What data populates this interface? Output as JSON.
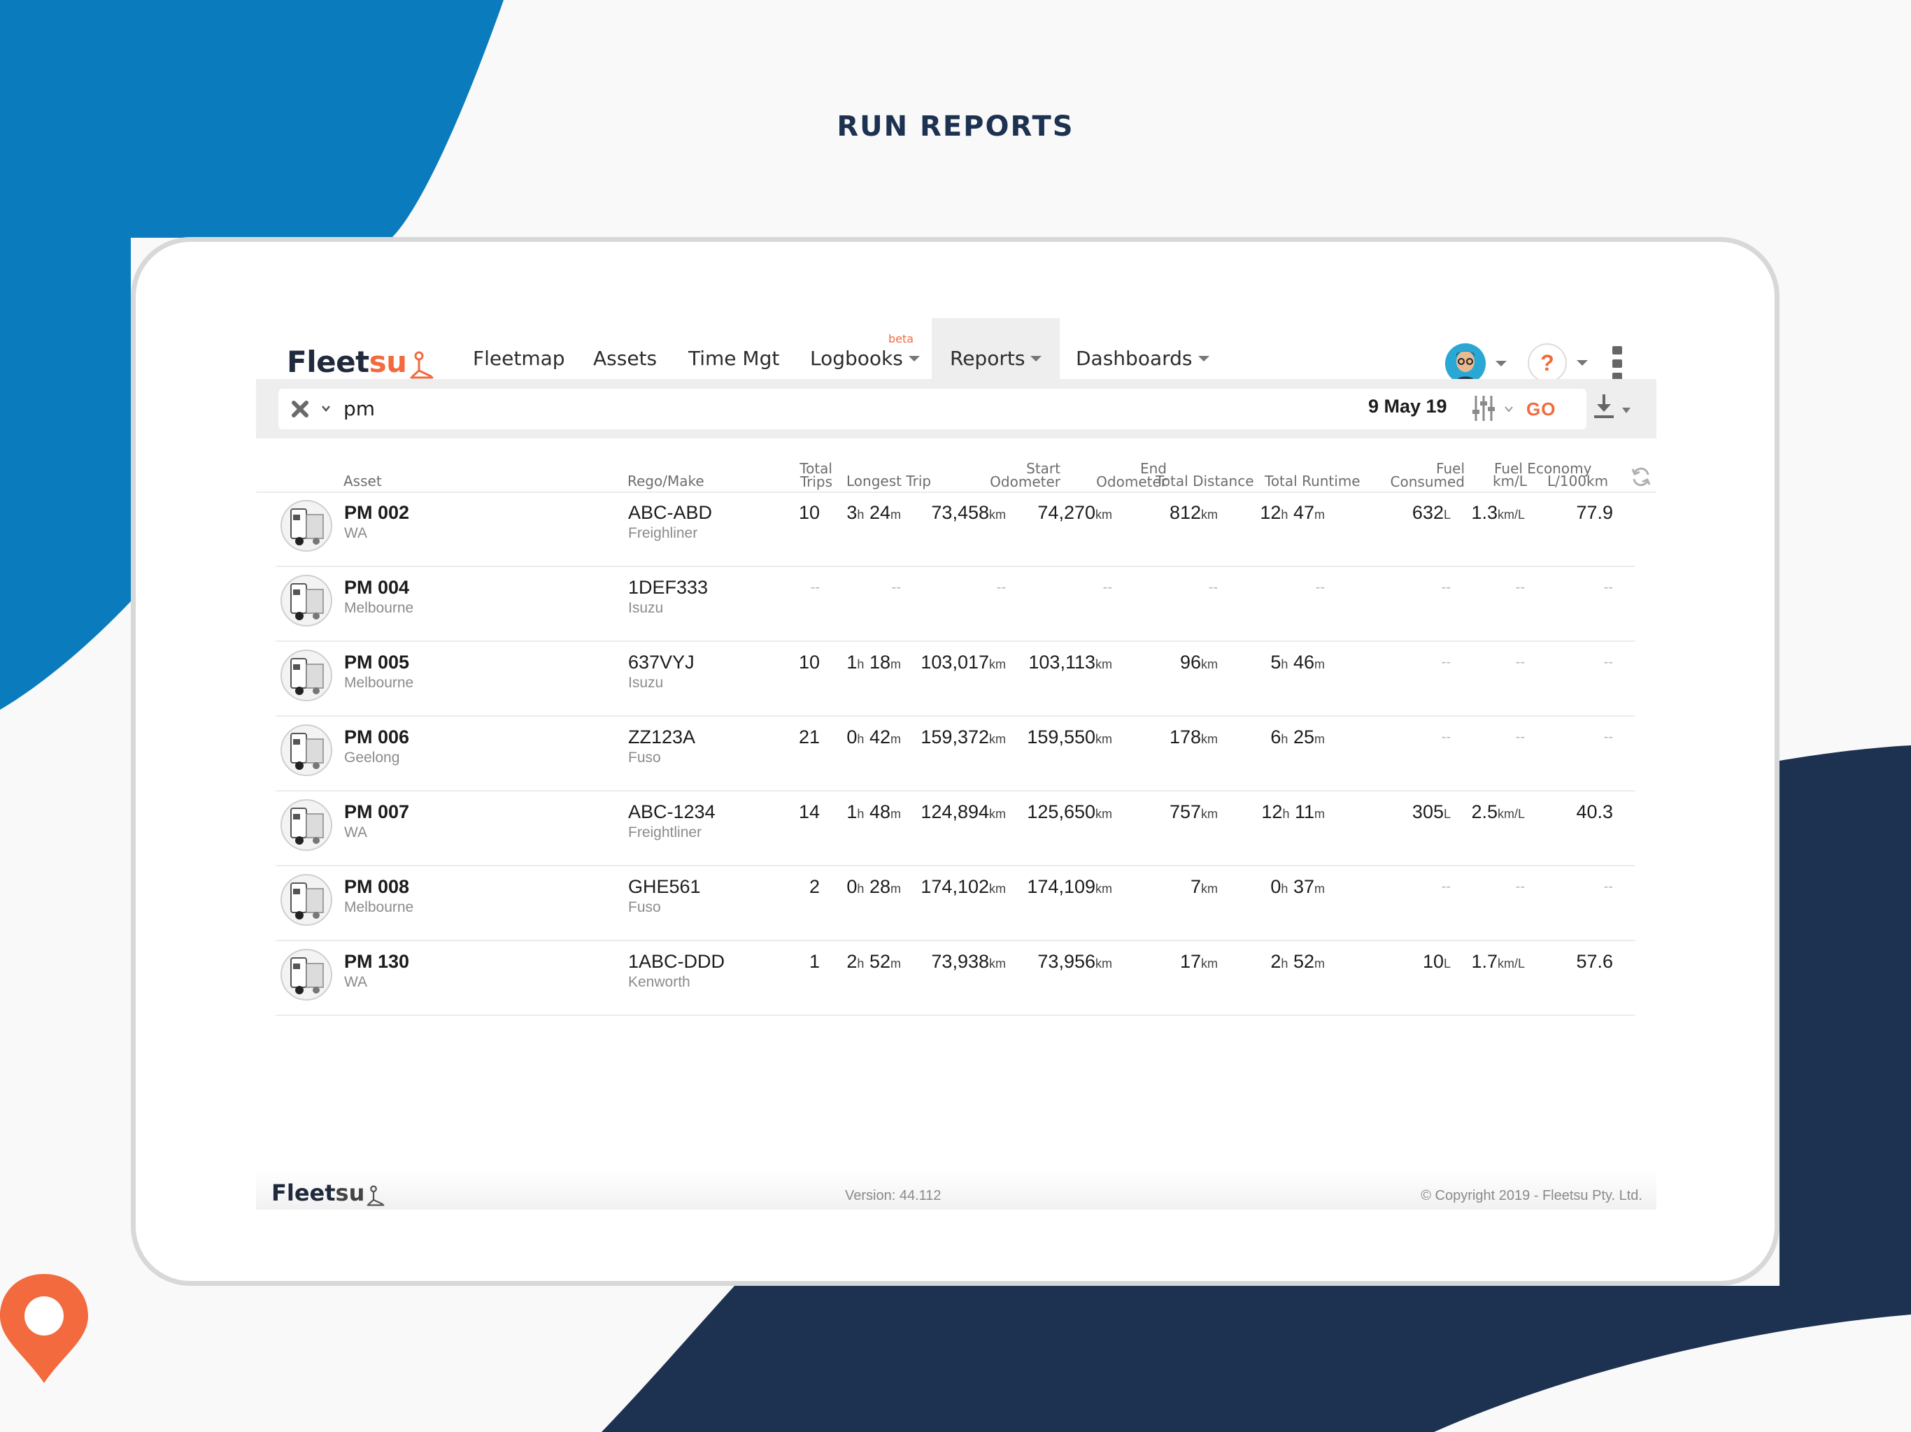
{
  "page_title": "RUN REPORTS",
  "colors": {
    "brand_blue": "#0a7bbd",
    "navy": "#1d3150",
    "accent_orange": "#f26a3d"
  },
  "app": {
    "logo": {
      "main": "Fleet",
      "accent": "su"
    },
    "nav": {
      "fleetmap": "Fleetmap",
      "assets": "Assets",
      "time_mgt": "Time Mgt",
      "logbooks": "Logbooks",
      "logbooks_badge": "beta",
      "reports": "Reports",
      "dashboards": "Dashboards"
    },
    "help_label": "?",
    "search": {
      "value": "pm"
    },
    "date": "9 May 19",
    "go_label": "GO"
  },
  "table": {
    "headers": {
      "asset": "Asset",
      "rego_make": "Rego/Make",
      "total_trips_1": "Total",
      "total_trips_2": "Trips",
      "longest_trip": "Longest Trip",
      "start_odometer_1": "Start",
      "start_odometer_2": "Odometer",
      "end_odometer_1": "End",
      "end_odometer_2": "Odometer",
      "total_distance": "Total Distance",
      "total_runtime": "Total Runtime",
      "fuel_consumed_1": "Fuel",
      "fuel_consumed_2": "Consumed",
      "fuel_economy": "Fuel Economy",
      "kml": "km/L",
      "l100km": "L/100km"
    },
    "units": {
      "h": "h",
      "m": "m",
      "km": "km",
      "L": "L",
      "kmL": "km/L",
      "dash": "--"
    },
    "rows": [
      {
        "name": "PM 002",
        "location": "WA",
        "rego": "ABC-ABD",
        "make": "Freighliner",
        "trips": "10",
        "longest_h": "3",
        "longest_m": "24",
        "start_odo": "73,458",
        "end_odo": "74,270",
        "distance": "812",
        "runtime_h": "12",
        "runtime_m": "47",
        "fuel": "632",
        "kml": "1.3",
        "l100": "77.9"
      },
      {
        "name": "PM 004",
        "location": "Melbourne",
        "rego": "1DEF333",
        "make": "Isuzu"
      },
      {
        "name": "PM 005",
        "location": "Melbourne",
        "rego": "637VYJ",
        "make": "Isuzu",
        "trips": "10",
        "longest_h": "1",
        "longest_m": "18",
        "start_odo": "103,017",
        "end_odo": "103,113",
        "distance": "96",
        "runtime_h": "5",
        "runtime_m": "46"
      },
      {
        "name": "PM 006",
        "location": "Geelong",
        "rego": "ZZ123A",
        "make": "Fuso",
        "trips": "21",
        "longest_h": "0",
        "longest_m": "42",
        "start_odo": "159,372",
        "end_odo": "159,550",
        "distance": "178",
        "runtime_h": "6",
        "runtime_m": "25"
      },
      {
        "name": "PM 007",
        "location": "WA",
        "rego": "ABC-1234",
        "make": "Freightliner",
        "trips": "14",
        "longest_h": "1",
        "longest_m": "48",
        "start_odo": "124,894",
        "end_odo": "125,650",
        "distance": "757",
        "runtime_h": "12",
        "runtime_m": "11",
        "fuel": "305",
        "kml": "2.5",
        "l100": "40.3"
      },
      {
        "name": "PM 008",
        "location": "Melbourne",
        "rego": "GHE561",
        "make": "Fuso",
        "trips": "2",
        "longest_h": "0",
        "longest_m": "28",
        "start_odo": "174,102",
        "end_odo": "174,109",
        "distance": "7",
        "runtime_h": "0",
        "runtime_m": "37"
      },
      {
        "name": "PM 130",
        "location": "WA",
        "rego": "1ABC-DDD",
        "make": "Kenworth",
        "trips": "1",
        "longest_h": "2",
        "longest_m": "52",
        "start_odo": "73,938",
        "end_odo": "73,956",
        "distance": "17",
        "runtime_h": "2",
        "runtime_m": "52",
        "fuel": "10",
        "kml": "1.7",
        "l100": "57.6"
      }
    ]
  },
  "footer": {
    "logo_main": "Fleet",
    "logo_accent": "su",
    "version": "Version: 44.112",
    "copyright": "© Copyright 2019 - Fleetsu Pty. Ltd."
  }
}
